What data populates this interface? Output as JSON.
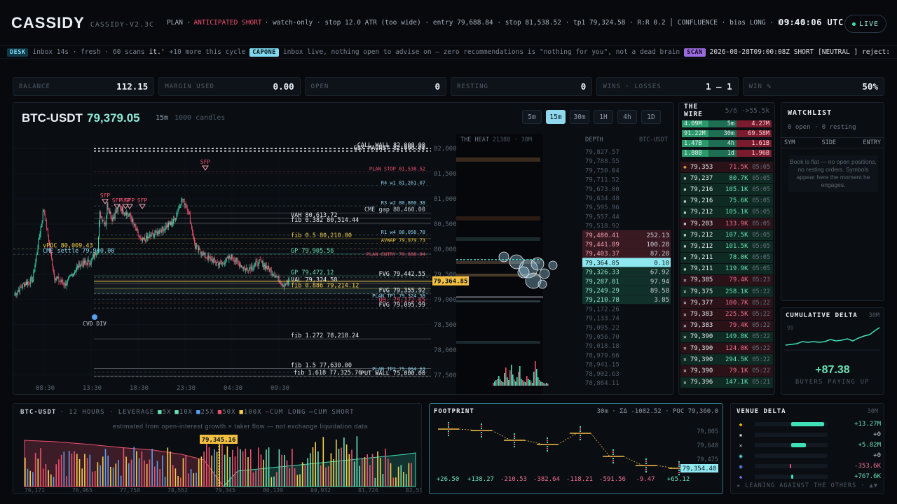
{
  "header": {
    "logo": "CASSIDY",
    "version": "CASSIDY-V2.3C",
    "plan_label": "PLAN ·",
    "plan_side": "ANTICIPATED SHORT",
    "plan_rest": "· watch-only · stop 12.0 ATR (too wide) · entry 79,688.84 · stop 81,538.52 · tp1 79,324.58 · R:R 0.2 │ CONFLUENCE · bias LONG · L 3 / S",
    "clock": "09:40:06 UTC",
    "live": "LIVE"
  },
  "ticker": {
    "desk_tag": "DESK",
    "desk_text": "inbox 14s · fresh · 60 scans",
    "desk_quote": "it.'",
    "more": "+10 more this cycle",
    "capone_tag": "CAPONE",
    "capone_text": "inbox live, nothing open to advise on — zero recommendations is \"nothing for you\", not a dead brain",
    "scan_tag": "SCAN",
    "scan_text": "2026-08-28T09:00:08Z SHORT [NEUTRAL ] reject:"
  },
  "stats": [
    {
      "label": "BALANCE",
      "value": "112.15"
    },
    {
      "label": "MARGIN USED",
      "value": "0.00"
    },
    {
      "label": "OPEN",
      "value": "0"
    },
    {
      "label": "RESTING",
      "value": "0"
    },
    {
      "label": "WINS · LOSSES",
      "value": "1 – 1"
    },
    {
      "label": "WIN %",
      "value": "50%"
    }
  ],
  "chart": {
    "symbol": "BTC-USDT",
    "price": "79,379.05",
    "timeframe": "15m",
    "candles": "1000 candles",
    "timeframes": [
      "5m",
      "15m",
      "30m",
      "1H",
      "4h",
      "1D"
    ],
    "active_timeframe": "15m",
    "heat_label": "THE HEAT",
    "heat_meta": "21388 · 30M",
    "depth_label": "DEPTH",
    "depth_pair": "BTC-USDT",
    "price_ticks": [
      "82,000",
      "81,500",
      "81,000",
      "80,500",
      "80,000",
      "79,500",
      "79,000",
      "78,500",
      "78,000",
      "77,500"
    ],
    "time_ticks": [
      "08:30",
      "13:30",
      "18:30",
      "23:30",
      "04:30",
      "09:30"
    ],
    "current_price_tag": "79,364.85",
    "levels": [
      {
        "text": "CALL WALL 82,000.00",
        "price": 82000,
        "color": "#e9eef4"
      },
      {
        "text": "GEX MAGNET 82,000.00",
        "price": 81950,
        "color": "#e9eef4"
      },
      {
        "text": "PLAN STOP 81,538.52",
        "price": 81538.52,
        "color": "#f0506e"
      },
      {
        "text": "R4 w1 81,261.07",
        "price": 81261.07,
        "color": "#8fd8ee"
      },
      {
        "text": "R3 w2 80,860.38",
        "price": 80860.38,
        "color": "#8fd8ee"
      },
      {
        "text": "CME gap 80,460.00",
        "price": 80720,
        "color": "#c8cfd8"
      },
      {
        "text": "VAH 80,613.72",
        "price": 80613.72,
        "color": "#e9eef4"
      },
      {
        "text": "fib 0.382 80,514.44",
        "price": 80514.44,
        "color": "#e9eef4"
      },
      {
        "text": "R1 w4 80,058.78",
        "price": 80280,
        "color": "#8fd8ee"
      },
      {
        "text": "fib 0.5 80,210.00",
        "price": 80210,
        "color": "#f5d04a"
      },
      {
        "text": "AVWAP 79,979.73",
        "price": 80120,
        "color": "#f5d04a"
      },
      {
        "text": "vPOC 80,009.43",
        "price": 80009.43,
        "color": "#f5d04a"
      },
      {
        "text": "CME settle 79,900.00",
        "price": 79900,
        "color": "#8fd8ee"
      },
      {
        "text": "GP 79,905.56",
        "price": 79905.56,
        "color": "#6be2b5"
      },
      {
        "text": "PLAN ENTRY 79,688.84",
        "price": 79840,
        "color": "#f0506e"
      },
      {
        "text": "GP 79,472.12",
        "price": 79472.12,
        "color": "#6be2b5"
      },
      {
        "text": "FVG 79,442.55",
        "price": 79442.55,
        "color": "#e9eef4"
      },
      {
        "text": "VAL 79,324.58",
        "price": 79324.58,
        "color": "#e9eef4"
      },
      {
        "text": "fib 0.886 79,214.12",
        "price": 79214.12,
        "color": "#f5d04a"
      },
      {
        "text": "FVG 79,355.92",
        "price": 79120,
        "color": "#e9eef4"
      },
      {
        "text": "PLAN TP1 79,324.58",
        "price": 79010,
        "color": "#8fd8ee"
      },
      {
        "text": "OB- 79,172.65",
        "price": 78930,
        "color": "#f0506e"
      },
      {
        "text": "FVG 79,095.99",
        "price": 78830,
        "color": "#e9eef4"
      },
      {
        "text": "fib 1.272 78,218.24",
        "price": 78218.24,
        "color": "#e9eef4"
      },
      {
        "text": "fib 1.5 77,630.00",
        "price": 77630,
        "color": "#e9eef4"
      },
      {
        "text": "PLAN TP2 75,064.63",
        "price": 77560,
        "color": "#8fd8ee"
      },
      {
        "text": "fib 1.618 77,325.76",
        "price": 77480,
        "color": "#e9eef4"
      },
      {
        "text": "PUT WALL 75,000.00",
        "price": 77470,
        "color": "#e9eef4"
      }
    ],
    "markers": [
      "SFP",
      "SFP",
      "SFP",
      "SFP",
      "SFP",
      "CVD DIV"
    ],
    "depth_asks": [
      "79,827.57",
      "79,788.55",
      "79,750.04",
      "79,711.52",
      "79,673.00",
      "79,634.48",
      "79,595.96",
      "79,557.44",
      "79,518.92",
      "79,480.41",
      "79,441.89",
      "79,403.37"
    ],
    "depth_ask_sizes": [
      "",
      "",
      "",
      "",
      "",
      "",
      "",
      "",
      "",
      "252.13",
      "100.28",
      "87.28"
    ],
    "depth_mid": "79,364.85",
    "depth_mid_size": "0.10",
    "depth_bids": [
      "79,326.33",
      "79,287.81",
      "79,249.29",
      "79,210.78",
      "79,172.26",
      "79,133.74",
      "79,095.22",
      "79,056.70",
      "79,018.18",
      "78,979.66",
      "78,941.15",
      "78,902.63",
      "78,864.11"
    ],
    "depth_bid_sizes": [
      "67.92",
      "97.94",
      "89.58",
      "3.85",
      "",
      "",
      "",
      "",
      "",
      "",
      "",
      "",
      ""
    ]
  },
  "wire": {
    "title": "THE WIRE",
    "count": "5/6",
    "filter": "·>55.5k",
    "summary": [
      {
        "l": "4.09M",
        "tf": "5m",
        "r": "4.27M"
      },
      {
        "l": "91.22M",
        "tf": "30m",
        "r": "69.58M"
      },
      {
        "l": "1.47B",
        "tf": "4h",
        "r": "1.61B"
      },
      {
        "l": "1.88B",
        "tf": "1d",
        "r": "1.96B"
      }
    ],
    "rows": [
      {
        "icon": "◆",
        "price": "79,353",
        "qty": "71.5K",
        "time": "05:05",
        "side": "sell"
      },
      {
        "icon": "▪",
        "price": "79,237",
        "qty": "80.7K",
        "time": "05:05",
        "side": "buy"
      },
      {
        "icon": "▪",
        "price": "79,216",
        "qty": "105.1K",
        "time": "05:05",
        "side": "buy"
      },
      {
        "icon": "▪",
        "price": "79,216",
        "qty": "75.6K",
        "time": "05:05",
        "side": "buy"
      },
      {
        "icon": "▪",
        "price": "79,212",
        "qty": "105.1K",
        "time": "05:05",
        "side": "buy"
      },
      {
        "icon": "▪",
        "price": "79,203",
        "qty": "133.9K",
        "time": "05:05",
        "side": "sell"
      },
      {
        "icon": "▪",
        "price": "79,212",
        "qty": "107.5K",
        "time": "05:05",
        "side": "buy"
      },
      {
        "icon": "▪",
        "price": "79,212",
        "qty": "101.5K",
        "time": "05:05",
        "side": "buy"
      },
      {
        "icon": "▪",
        "price": "79,211",
        "qty": "78.0K",
        "time": "05:05",
        "side": "buy"
      },
      {
        "icon": "▪",
        "price": "79,211",
        "qty": "119.9K",
        "time": "05:05",
        "side": "buy"
      },
      {
        "icon": "✕",
        "price": "79,385",
        "qty": "79.4K",
        "time": "05:23",
        "side": "sell"
      },
      {
        "icon": "✕",
        "price": "79,375",
        "qty": "258.1K",
        "time": "05:22",
        "side": "buy"
      },
      {
        "icon": "✕",
        "price": "79,377",
        "qty": "100.7K",
        "time": "05:22",
        "side": "sell"
      },
      {
        "icon": "✕",
        "price": "79,383",
        "qty": "225.5K",
        "time": "05:22",
        "side": "sell"
      },
      {
        "icon": "✕",
        "price": "79,383",
        "qty": "79.4K",
        "time": "05:22",
        "side": "sell"
      },
      {
        "icon": "✕",
        "price": "79,390",
        "qty": "149.8K",
        "time": "05:22",
        "side": "buy"
      },
      {
        "icon": "✕",
        "price": "79,390",
        "qty": "124.0K",
        "time": "05:22",
        "side": "sell"
      },
      {
        "icon": "✕",
        "price": "79,390",
        "qty": "294.5K",
        "time": "05:22",
        "side": "buy"
      },
      {
        "icon": "✕",
        "price": "79,390",
        "qty": "79.1K",
        "time": "05:22",
        "side": "sell"
      },
      {
        "icon": "✕",
        "price": "79,396",
        "qty": "147.1K",
        "time": "05:21",
        "side": "buy"
      }
    ]
  },
  "watchlist": {
    "title": "WATCHLIST",
    "sub": "0 open · 0 resting",
    "cols": [
      "SYM",
      "SIDE",
      "ENTRY"
    ],
    "empty": "Book is flat — no open positions, no resting orders. Symbols appear here the moment he engages."
  },
  "cum_delta": {
    "title": "CUMULATIVE DELTA",
    "tf": "30M",
    "axis": "90",
    "value": "+87.38",
    "caption": "BUYERS PAYING UP"
  },
  "liquidations": {
    "symbol": "BTC-USDT",
    "hours": "· 12 HOURS · LEVERAGE",
    "legend": [
      "5X",
      "10X",
      "25X",
      "50X",
      "100X",
      "CUM LONG",
      "CUM SHORT"
    ],
    "legend_colors": [
      "#6be2b5",
      "#6be2b5",
      "#5aa0f0",
      "#f0506e",
      "#f5d04a",
      "#f0506e",
      "#6be2b5"
    ],
    "note": "estimated from open-interest growth × taker flow — not exchange liquidation data",
    "marker": "79,345.16",
    "x_ticks": [
      "76,171",
      "76,965",
      "77,758",
      "78,552",
      "79,345",
      "80,139",
      "80,932",
      "81,726",
      "82,519"
    ]
  },
  "footprint": {
    "title": "FOOTPRINT",
    "meta": "30m · ΣΔ -1082.52 · POC 79,360.0",
    "y_ticks": [
      "79,805",
      "79,640",
      "79,475"
    ],
    "price_tag": "79,354.40",
    "deltas": [
      "+26.50",
      "+138.27",
      "-210.53",
      "-382.64",
      "-118.21",
      "-591.56",
      "-9.47",
      "+65.12"
    ]
  },
  "venue_delta": {
    "title": "VENUE DELTA",
    "tf": "30M",
    "rows": [
      {
        "icon": "binance-icon",
        "glyph": "◆",
        "color": "#f0b90b",
        "value": "+13.27M",
        "fill": 0.9,
        "side": "pos"
      },
      {
        "icon": "okx-icon",
        "glyph": "▪",
        "color": "#c8cfd8",
        "value": "+0",
        "fill": 0.0,
        "side": "pos"
      },
      {
        "icon": "bybit-icon",
        "glyph": "✕",
        "color": "#c8cfd8",
        "value": "+5.82M",
        "fill": 0.4,
        "side": "pos"
      },
      {
        "icon": "hyperliquid-icon",
        "glyph": "◉",
        "color": "#5fd8e8",
        "value": "+0",
        "fill": 0.0,
        "side": "pos"
      },
      {
        "icon": "coinbase-icon",
        "glyph": "◉",
        "color": "#5a8af0",
        "value": "-353.6K",
        "fill": 0.03,
        "side": "neg"
      },
      {
        "icon": "kraken-icon",
        "glyph": "◆",
        "color": "#8a5af0",
        "value": "+767.6K",
        "fill": 0.06,
        "side": "pos"
      }
    ],
    "foot": "★ LEANING AGAINST THE OTHERS · ▲▼"
  }
}
